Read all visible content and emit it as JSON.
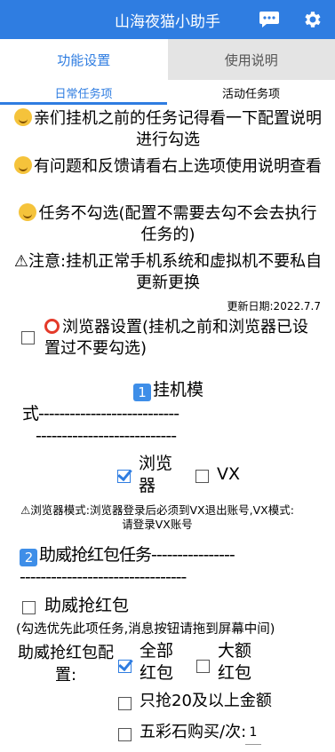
{
  "header": {
    "title": "山海夜猫小助手"
  },
  "tabs": [
    {
      "label": "功能设置"
    },
    {
      "label": "使用说明"
    }
  ],
  "subtabs": [
    {
      "label": "日常任务项"
    },
    {
      "label": "活动任务项"
    }
  ],
  "notices": [
    "亲们挂机之前的任务记得看一下配置说明进行勾选",
    "有问题和反馈请看右上选项使用说明查看",
    "任务不勾选(配置不需要去勾不会去执行任务的)",
    "⚠注意:挂机正常手机系统和虚拟机不要私自更新更换"
  ],
  "update_date": "更新日期:2022.7.7",
  "browser_setting": {
    "label": "浏览器设置(挂机之前和浏览器已设置过不要勾选)",
    "checked": false
  },
  "section1": {
    "badge": "1",
    "title": "挂机模",
    "title_cont": "式",
    "dashes_1": "---------------------------",
    "dashes_2": "---------------------------",
    "options": [
      {
        "label": "浏览器",
        "checked": true
      },
      {
        "label": "VX",
        "checked": false
      }
    ],
    "note": "⚠浏览器模式:浏览器登录后必须到VX退出账号,VX模式:请登录VX账号"
  },
  "section2": {
    "badge": "2",
    "title": "助威抢红包任务",
    "dashes_1": "----------------",
    "dashes_2": "--------------------------------",
    "main_option": {
      "label": "助威抢红包",
      "checked": false
    },
    "hint": "(勾选优先此项任务,消息按钮请拖到屏幕中间)",
    "config_label": "助威抢红包配置:",
    "options": [
      {
        "label": "全部红包",
        "checked": true
      },
      {
        "label": "大额红包",
        "checked": false
      }
    ],
    "only_20": {
      "label": "只抢20及以上金额",
      "checked": false
    },
    "stone": {
      "label": "五彩石购买/次:",
      "checked": false,
      "value": "1"
    }
  }
}
